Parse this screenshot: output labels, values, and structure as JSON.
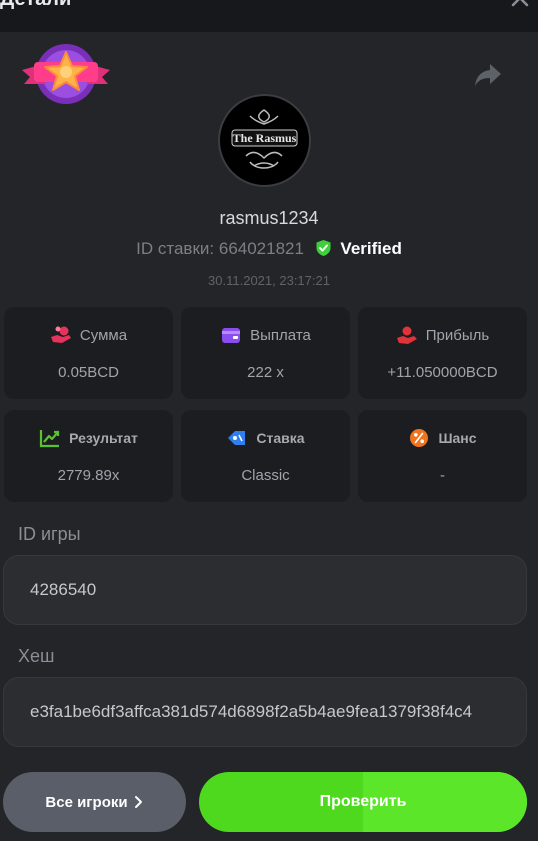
{
  "header": {
    "title": "Детали"
  },
  "player": {
    "username": "rasmus1234",
    "avatar_label": "The Rasmus"
  },
  "bet": {
    "id_label": "ID ставки:",
    "id_value": "664021821",
    "verified_label": "Verified",
    "datetime": "30.11.2021, 23:17:21"
  },
  "stats": [
    {
      "label": "Сумма",
      "value": "0.05BCD",
      "icon": "coins-hand-icon",
      "color": "#e6325c"
    },
    {
      "label": "Выплата",
      "value": "222 x",
      "icon": "wallet-icon",
      "color": "#8a4df0"
    },
    {
      "label": "Прибыль",
      "value": "+11.050000BCD",
      "icon": "profit-hand-icon",
      "color": "#e2323a"
    },
    {
      "label": "Результат",
      "value": "2779.89x",
      "icon": "growth-chart-icon",
      "color": "#59c22e"
    },
    {
      "label": "Ставка",
      "value": "Classic",
      "icon": "tag-icon",
      "color": "#2f7ff0"
    },
    {
      "label": "Шанс",
      "value": "-",
      "icon": "percent-icon",
      "color": "#f0731e"
    }
  ],
  "game_id": {
    "label": "ID игры",
    "value": "4286540"
  },
  "hash": {
    "label": "Хеш",
    "value": "e3fa1be6df3affca381d574d6898f2a5b4ae9fea1379f38f4c4"
  },
  "buttons": {
    "all_players": "Все игроки",
    "verify": "Проверить"
  }
}
